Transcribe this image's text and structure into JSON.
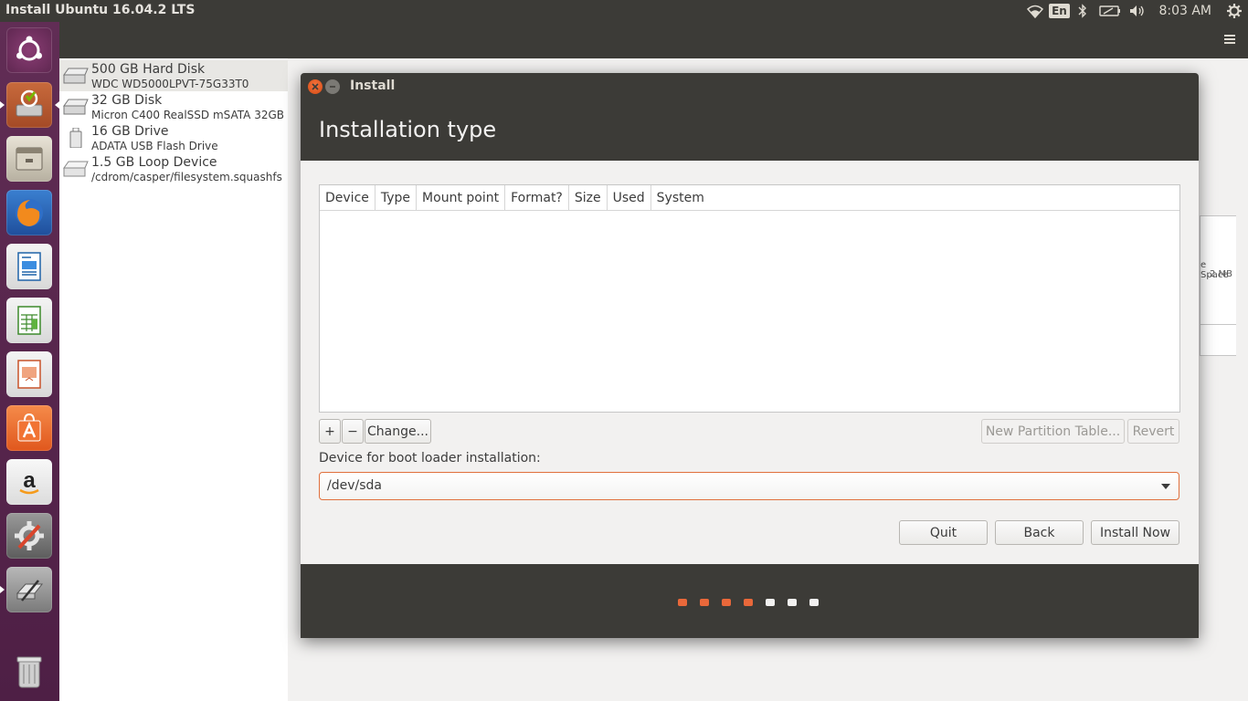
{
  "top_panel": {
    "title": "Install Ubuntu 16.04.2 LTS",
    "lang": "En",
    "clock": "8:03 AM"
  },
  "launcher": {
    "items": [
      {
        "icon": "ubuntu-dash-icon"
      },
      {
        "icon": "installer-icon"
      },
      {
        "icon": "files-icon"
      },
      {
        "icon": "firefox-icon"
      },
      {
        "icon": "writer-icon"
      },
      {
        "icon": "calc-icon"
      },
      {
        "icon": "impress-icon"
      },
      {
        "icon": "software-center-icon"
      },
      {
        "icon": "amazon-icon"
      },
      {
        "icon": "system-settings-icon"
      },
      {
        "icon": "disks-icon"
      },
      {
        "icon": "trash-icon"
      }
    ]
  },
  "disks": [
    {
      "name": "500 GB Hard Disk",
      "sub": "WDC WD5000LPVT-75G33T0"
    },
    {
      "name": "32 GB Disk",
      "sub": "Micron C400 RealSSD mSATA 32GB"
    },
    {
      "name": "16 GB Drive",
      "sub": "ADATA USB Flash Drive"
    },
    {
      "name": "1.5 GB Loop Device",
      "sub": "/cdrom/casper/filesystem.squashfs"
    }
  ],
  "background": {
    "free_space_label": "e Space",
    "free_space_size": ".2 MB"
  },
  "dialog": {
    "title": "Install",
    "heading": "Installation type",
    "columns": [
      "Device",
      "Type",
      "Mount point",
      "Format?",
      "Size",
      "Used",
      "System"
    ],
    "add_label": "+",
    "remove_label": "−",
    "change_label": "Change...",
    "new_table_label": "New Partition Table...",
    "revert_label": "Revert",
    "boot_label": "Device for boot loader installation:",
    "boot_value": "/dev/sda",
    "quit_label": "Quit",
    "back_label": "Back",
    "install_label": "Install Now"
  },
  "progress": {
    "total_steps": 7,
    "completed_steps": 4,
    "active_color": "#e9683a",
    "inactive_color": "#f2f1f0"
  }
}
